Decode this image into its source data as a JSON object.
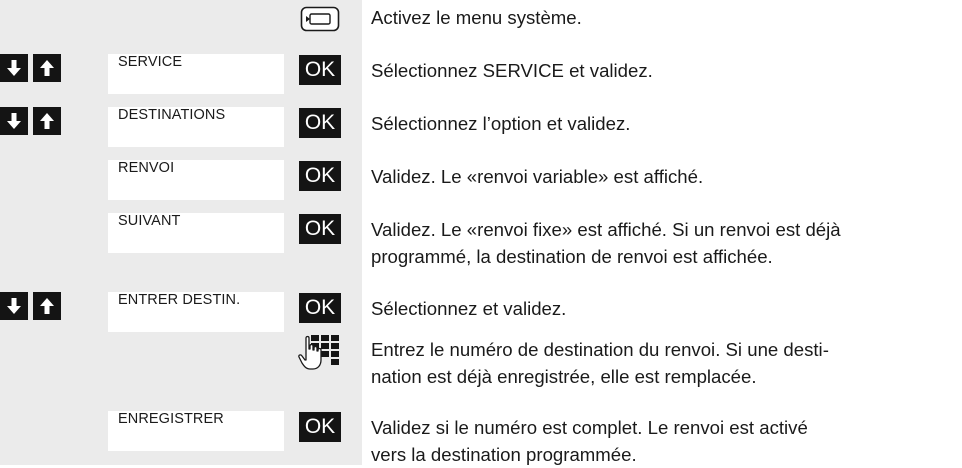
{
  "steps": [
    {
      "nav_arrows": false,
      "display": "",
      "key": "menu-key",
      "text": "Activez le menu système."
    },
    {
      "nav_arrows": true,
      "display": "SERVICE",
      "key": "OK",
      "text": "Sélectionnez SERVICE et validez."
    },
    {
      "nav_arrows": true,
      "display": "DESTINATIONS",
      "key": "OK",
      "text": "Sélectionnez l’option et validez."
    },
    {
      "nav_arrows": false,
      "display": "RENVOI",
      "key": "OK",
      "text": "Validez. Le «renvoi variable» est affiché."
    },
    {
      "nav_arrows": false,
      "display": "SUIVANT",
      "key": "OK",
      "text_line1": "Validez. Le «renvoi fixe» est affiché. Si un renvoi est déjà",
      "text_line2": "programmé, la destination de renvoi est affichée."
    },
    {
      "nav_arrows": true,
      "display": "ENTRER DESTIN.",
      "key": "OK",
      "text": "Sélectionnez et validez."
    },
    {
      "nav_arrows": false,
      "display": "",
      "key": "keypad-icon",
      "text_line1": "Entrez le numéro de destination du renvoi. Si une desti-",
      "text_line2": "nation est déjà enregistrée, elle est remplacée."
    },
    {
      "nav_arrows": false,
      "display": "ENREGISTRER",
      "key": "OK",
      "text_line1": "Validez si le numéro est complet. Le renvoi est activé",
      "text_line2": "vers la destination programmée."
    }
  ],
  "icons": {
    "down_arrow": "arrow-down-icon",
    "up_arrow": "arrow-up-icon",
    "menu_key": "menu-key-icon",
    "keypad": "keypad-icon"
  },
  "colors": {
    "panel": "#ebebeb",
    "key": "#141414"
  }
}
